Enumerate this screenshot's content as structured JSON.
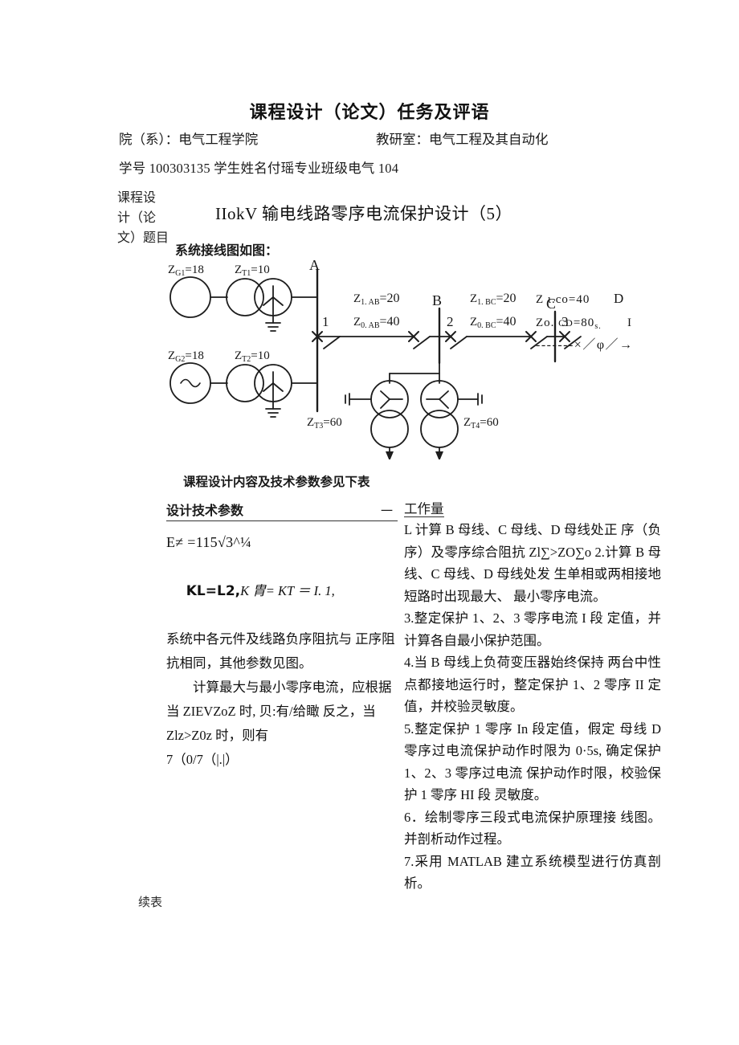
{
  "header": {
    "doc_title": "课程设计（论文）任务及评语",
    "department_label": "院（系）：电气工程学院",
    "office_label": "教研室：电气工程及其自动化",
    "student_line": "学号 100303135 学生姓名付瑶专业班级电气 104"
  },
  "title_block": {
    "row_label": "课程设\n计（论\n文）题目",
    "subject": "IIokV 输电线路零序电流保护设计（5）"
  },
  "diagram": {
    "caption": "系统接线图如图：",
    "labels": {
      "zg1": "ZG1=18",
      "zt1": "ZT1=10",
      "zg2": "ZG2=18",
      "zt2": "ZT2=10",
      "zt3": "ZT3=60",
      "zt4": "ZT4=60",
      "bus_a": "A",
      "bus_b": "B",
      "bus_c": "C",
      "bus_d": "D",
      "cb1": "1",
      "cb2": "2",
      "cb3": "3",
      "z1_ab": "Z1. AB=20",
      "z0_ab": "Z0. AB=40",
      "z1_bc": "Z1. BC=20",
      "z0_bc": "Z0. BC=40",
      "z1_cd": "Z ι.co=40",
      "z0_cd": "Zo. CD=80s.",
      "tail_i": "I",
      "dash_note": "-------×／φ／→"
    }
  },
  "mid_caption": "课程设计内容及技术参数参见下表",
  "left_column": {
    "heading": "设计技术参数",
    "heading_tail": "一",
    "lines": [
      "E≠ =115√3^¼",
      "KL=L2,",
      "K 胄= KT ＝ I. 1,",
      "系统中各元件及线路负序阻抗与 正序阻抗相同，其他参数见图。",
      "计算最大与最小零序电流，应根据当 ZIEVZoZ 时, 贝:有/给瞰 反之，当 Zlz>Z0z 时，则有",
      "7（0/7（|.|）"
    ]
  },
  "right_column": {
    "heading": "工作量",
    "items": [
      "L 计算 B 母线、C 母线、D 母线处正 序（负序）及零序综合阻抗 Zl∑>ZO∑o 2.计算 B 母线、C 母线、D 母线处发 生单相或两相接地短路时出现最大、 最小零序电流。",
      "3.整定保护 1、2、3 零序电流 I 段 定值，并计算各自最小保护范围。",
      "4.当 B 母线上负荷变压器始终保持 两台中性点都接地运行时，整定保护 1、2 零序 II 定值，并校验灵敏度。",
      "5.整定保护 1 零序 In 段定值，假定 母线 D 零序过电流保护动作时限为 0·5s, 确定保护 1、2、3 零序过电流 保护动作时限，校验保护 1 零序 HI 段 灵敏度。",
      "6．绘制零序三段式电流保护原理接 线图。并剖析动作过程。",
      "7.采用 MATLAB 建立系统模型进行仿真剖析。"
    ]
  },
  "footer": {
    "continue_note": "续表"
  }
}
